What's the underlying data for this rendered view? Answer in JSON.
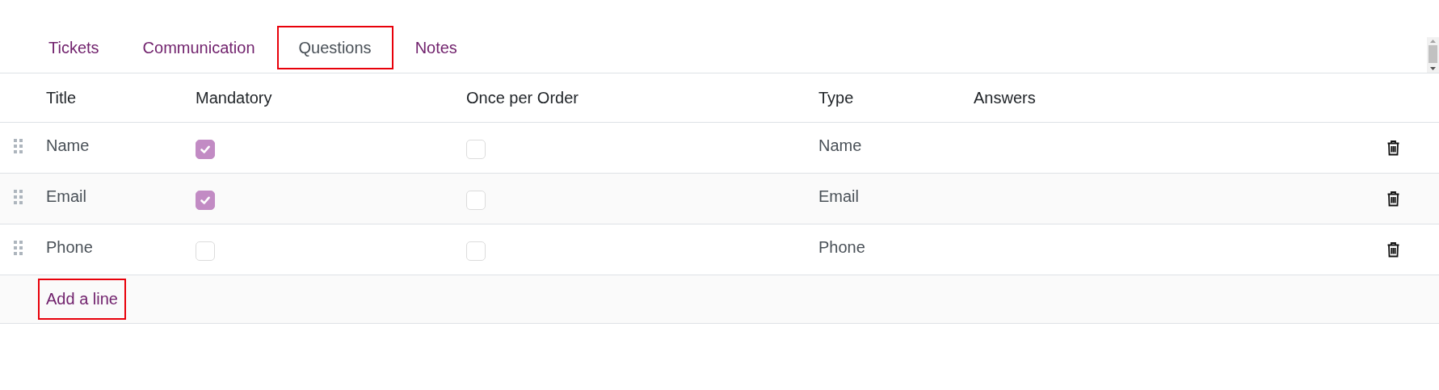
{
  "tabs": [
    {
      "label": "Tickets",
      "selected": false,
      "highlighted": false
    },
    {
      "label": "Communication",
      "selected": false,
      "highlighted": false
    },
    {
      "label": "Questions",
      "selected": true,
      "highlighted": true
    },
    {
      "label": "Notes",
      "selected": false,
      "highlighted": false
    }
  ],
  "table": {
    "columns": [
      "Title",
      "Mandatory",
      "Once per Order",
      "Type",
      "Answers"
    ],
    "rows": [
      {
        "title": "Name",
        "mandatory": true,
        "once_per_order": false,
        "type": "Name"
      },
      {
        "title": "Email",
        "mandatory": true,
        "once_per_order": false,
        "type": "Email"
      },
      {
        "title": "Phone",
        "mandatory": false,
        "once_per_order": false,
        "type": "Phone"
      }
    ],
    "add_line": {
      "label": "Add a line",
      "highlighted": true
    }
  }
}
